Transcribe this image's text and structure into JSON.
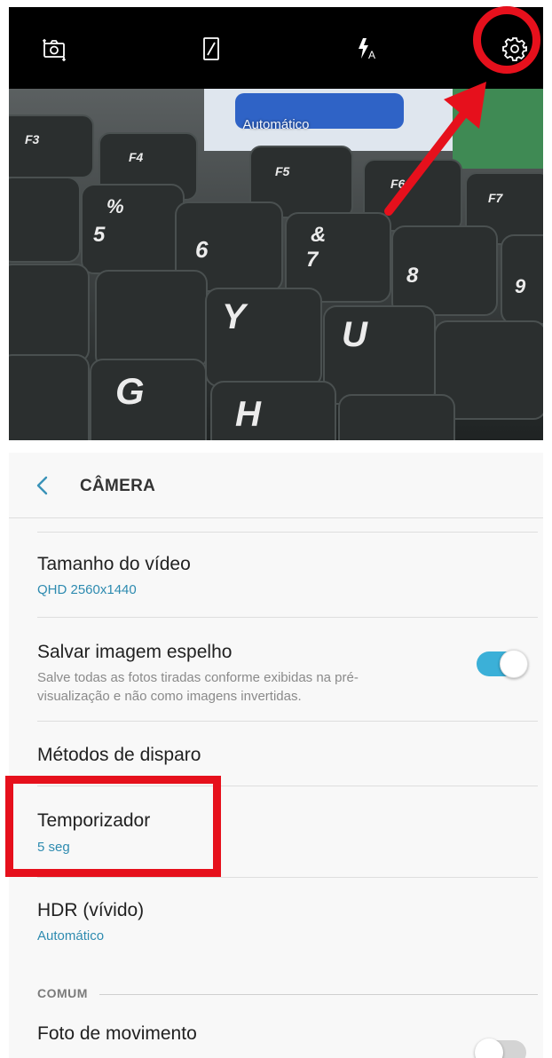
{
  "camera": {
    "mode_label": "Automático",
    "buttons": {
      "switch": "switch-camera-icon",
      "ratio": "aspect-ratio-icon",
      "flash": "flash-auto-icon",
      "settings": "gear-icon"
    },
    "annotation_color": "#e6101c"
  },
  "settings": {
    "title": "CÂMERA",
    "items": [
      {
        "title": "Tamanho do vídeo",
        "value": "QHD 2560x1440"
      },
      {
        "title": "Salvar imagem espelho",
        "description": "Salve todas as fotos tiradas conforme exibidas na pré-visualização e não como imagens invertidas.",
        "toggle": true
      },
      {
        "title": "Métodos de disparo"
      },
      {
        "title": "Temporizador",
        "value": "5 seg"
      },
      {
        "title": "HDR (vívido)",
        "value": "Automático"
      }
    ],
    "section_common": "COMUM",
    "motion_photo": {
      "title": "Foto de movimento",
      "toggle": false
    },
    "accent_color": "#3bb0d8"
  }
}
